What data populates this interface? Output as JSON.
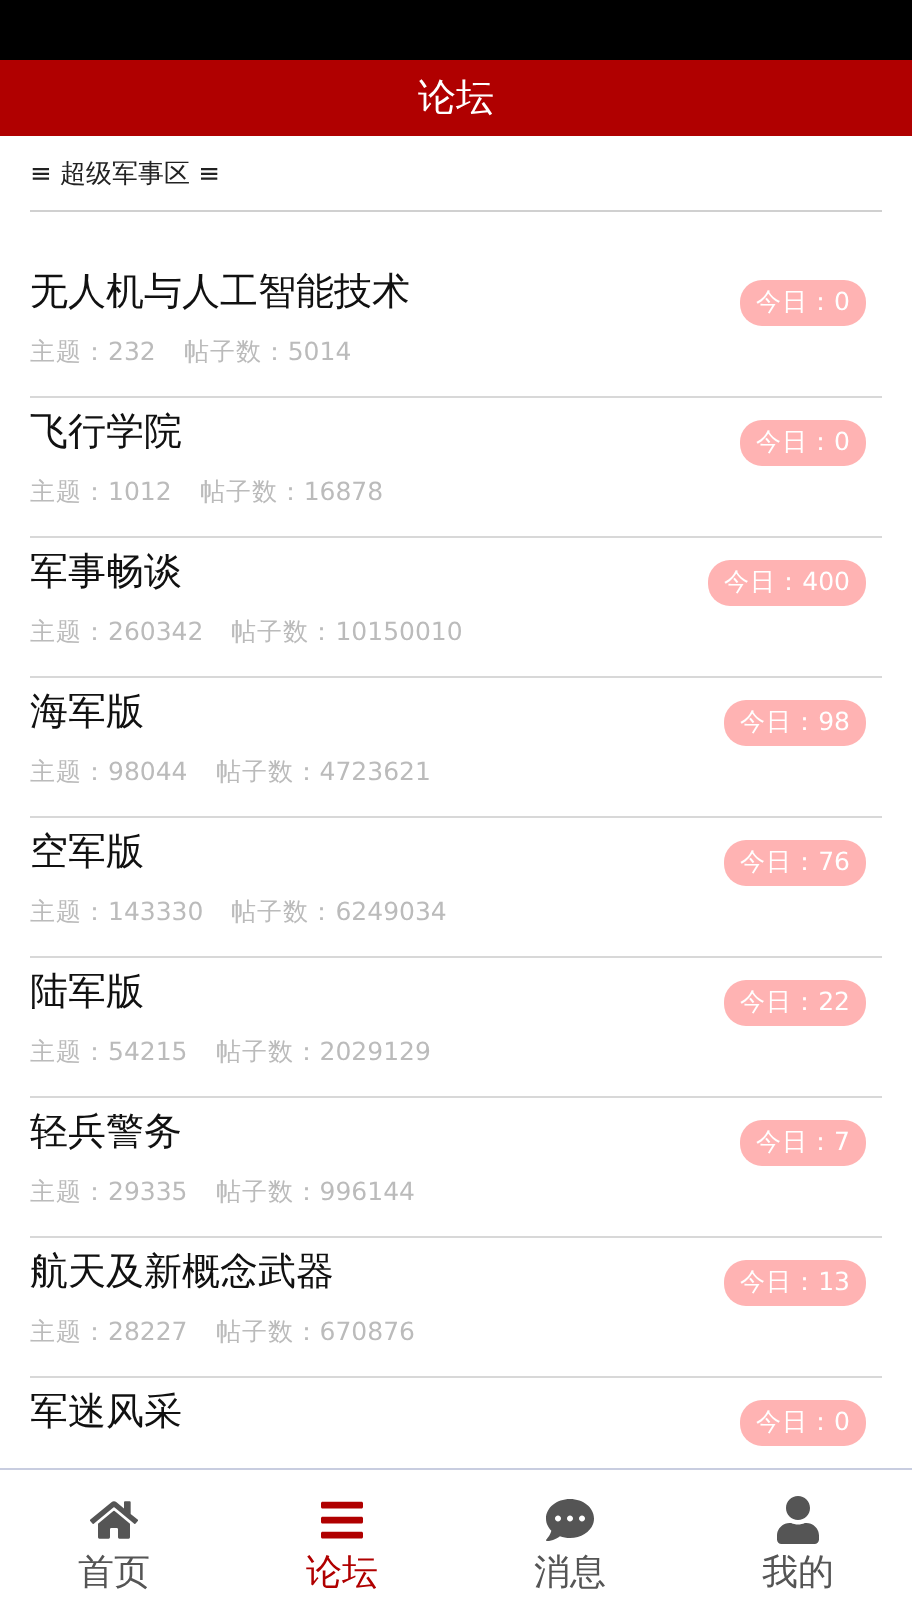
{
  "header": {
    "title": "论坛"
  },
  "section": {
    "title": "≡ 超级军事区 ≡"
  },
  "forums": [
    {
      "name": "无人机与人工智能技术",
      "today": "今日：0",
      "topics": "主题：232",
      "posts": "帖子数：5014"
    },
    {
      "name": "飞行学院",
      "today": "今日：0",
      "topics": "主题：1012",
      "posts": "帖子数：16878"
    },
    {
      "name": "军事畅谈",
      "today": "今日：400",
      "topics": "主题：260342",
      "posts": "帖子数：10150010"
    },
    {
      "name": "海军版",
      "today": "今日：98",
      "topics": "主题：98044",
      "posts": "帖子数：4723621"
    },
    {
      "name": "空军版",
      "today": "今日：76",
      "topics": "主题：143330",
      "posts": "帖子数：6249034"
    },
    {
      "name": "陆军版",
      "today": "今日：22",
      "topics": "主题：54215",
      "posts": "帖子数：2029129"
    },
    {
      "name": "轻兵警务",
      "today": "今日：7",
      "topics": "主题：29335",
      "posts": "帖子数：996144"
    },
    {
      "name": "航天及新概念武器",
      "today": "今日：13",
      "topics": "主题：28227",
      "posts": "帖子数：670876"
    },
    {
      "name": "军迷风采",
      "today": "今日：0"
    }
  ],
  "tabs": [
    {
      "kind": "home",
      "label": "首页",
      "selected": false
    },
    {
      "kind": "forum",
      "label": "论坛",
      "selected": true
    },
    {
      "kind": "messages",
      "label": "消息",
      "selected": false
    },
    {
      "kind": "profile",
      "label": "我的",
      "selected": false
    }
  ]
}
